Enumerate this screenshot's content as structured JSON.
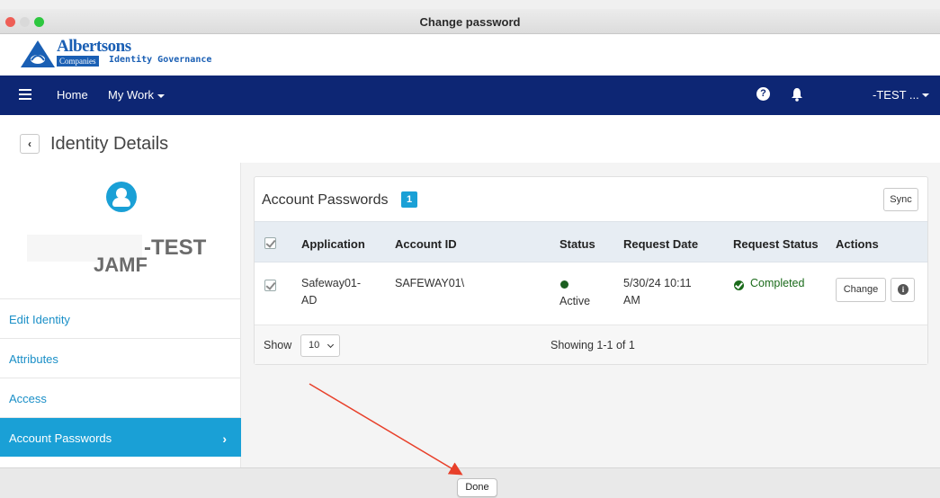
{
  "window": {
    "title": "Change password"
  },
  "brand": {
    "name": "Albertsons",
    "sub": "Companies",
    "product": "Identity Governance",
    "color": "#1a5fb4"
  },
  "navbar": {
    "home": "Home",
    "my_work": "My Work",
    "user": "-TEST ...",
    "background": "#0d2674"
  },
  "page": {
    "back_icon": "‹",
    "title": "Identity Details"
  },
  "identity": {
    "name_line1": "-TEST",
    "name_line2": "JAMF"
  },
  "sidebar": {
    "items": [
      {
        "label": "Edit Identity"
      },
      {
        "label": "Attributes"
      },
      {
        "label": "Access"
      },
      {
        "label": "Account Passwords",
        "active": true
      }
    ],
    "accent": "#1aa0d6"
  },
  "panel": {
    "title": "Account Passwords",
    "count": "1",
    "sync_label": "Sync",
    "columns": [
      "Application",
      "Account ID",
      "Status",
      "Request Date",
      "Request Status",
      "Actions"
    ],
    "rows": [
      {
        "application_l1": "Safeway01-",
        "application_l2": "AD",
        "account_id": "SAFEWAY01\\",
        "status": "Active",
        "request_date_l1": "5/30/24 10:11",
        "request_date_l2": "AM",
        "request_status": "Completed",
        "action_label": "Change"
      }
    ],
    "footer": {
      "show_label": "Show",
      "page_size": "10",
      "showing": "Showing 1-1 of 1"
    }
  },
  "dialog": {
    "done_label": "Done"
  },
  "annotation": {
    "arrow_color": "#e8402a"
  }
}
